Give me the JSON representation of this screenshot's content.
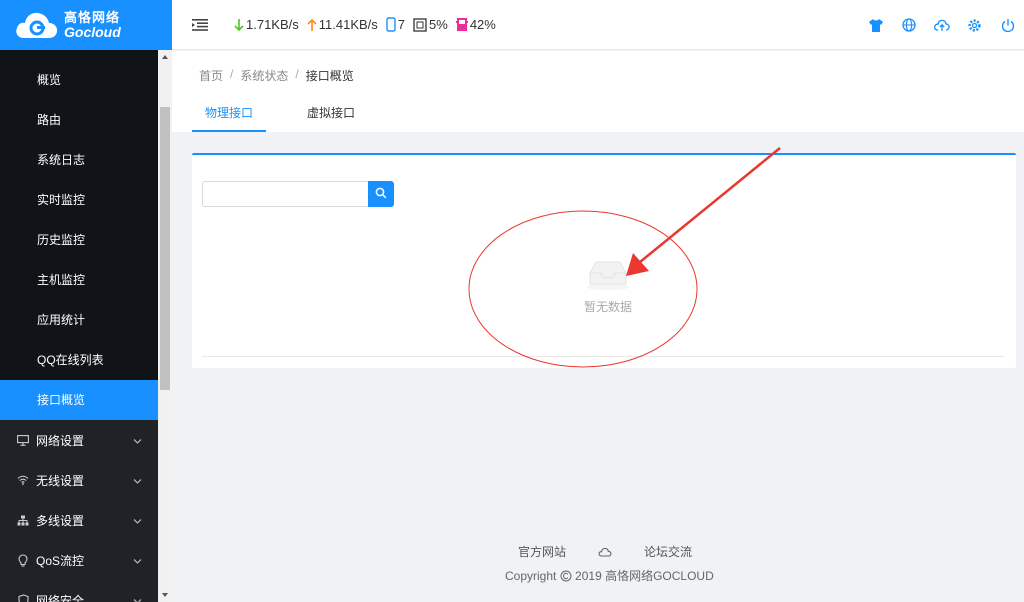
{
  "logo": {
    "cn": "高恪网络",
    "en": "Gocloud"
  },
  "header": {
    "download_speed": "1.71KB/s",
    "upload_speed": "11.41KB/s",
    "devices": "7",
    "cpu": "5%",
    "memory": "42%",
    "icons": [
      "shirt-icon",
      "globe-icon",
      "cloud-upload-icon",
      "gear-icon",
      "power-icon"
    ]
  },
  "sidebar": {
    "submenu": [
      {
        "label": "概览"
      },
      {
        "label": "路由"
      },
      {
        "label": "系统日志"
      },
      {
        "label": "实时监控"
      },
      {
        "label": "历史监控"
      },
      {
        "label": "主机监控"
      },
      {
        "label": "应用统计"
      },
      {
        "label": "QQ在线列表"
      },
      {
        "label": "接口概览",
        "active": true
      }
    ],
    "menu": [
      {
        "label": "网络设置",
        "icon": "monitor-icon"
      },
      {
        "label": "无线设置",
        "icon": "wifi-icon"
      },
      {
        "label": "多线设置",
        "icon": "sitemap-icon"
      },
      {
        "label": "QoS流控",
        "icon": "bulb-icon"
      },
      {
        "label": "网络安全",
        "icon": "shield-icon"
      }
    ]
  },
  "breadcrumb": {
    "home": "首页",
    "section": "系统状态",
    "current": "接口概览",
    "separator": "/"
  },
  "tabs": [
    {
      "label": "物理接口",
      "active": true
    },
    {
      "label": "虚拟接口",
      "active": false
    }
  ],
  "search": {
    "value": "",
    "placeholder": ""
  },
  "table": {
    "empty_text": "暂无数据"
  },
  "footer": {
    "link_official": "官方网站",
    "link_forum": "论坛交流",
    "copyright": "Copyright",
    "copyright_rest": "2019 高恪网络GOCLOUD"
  },
  "colors": {
    "primary": "#1890ff",
    "sidebar": "#1f2328",
    "sidebar_sub": "#101317",
    "download": "#52c41a",
    "upload": "#fa8c16",
    "memory": "#eb2f96",
    "annotation": "#e8382f"
  }
}
